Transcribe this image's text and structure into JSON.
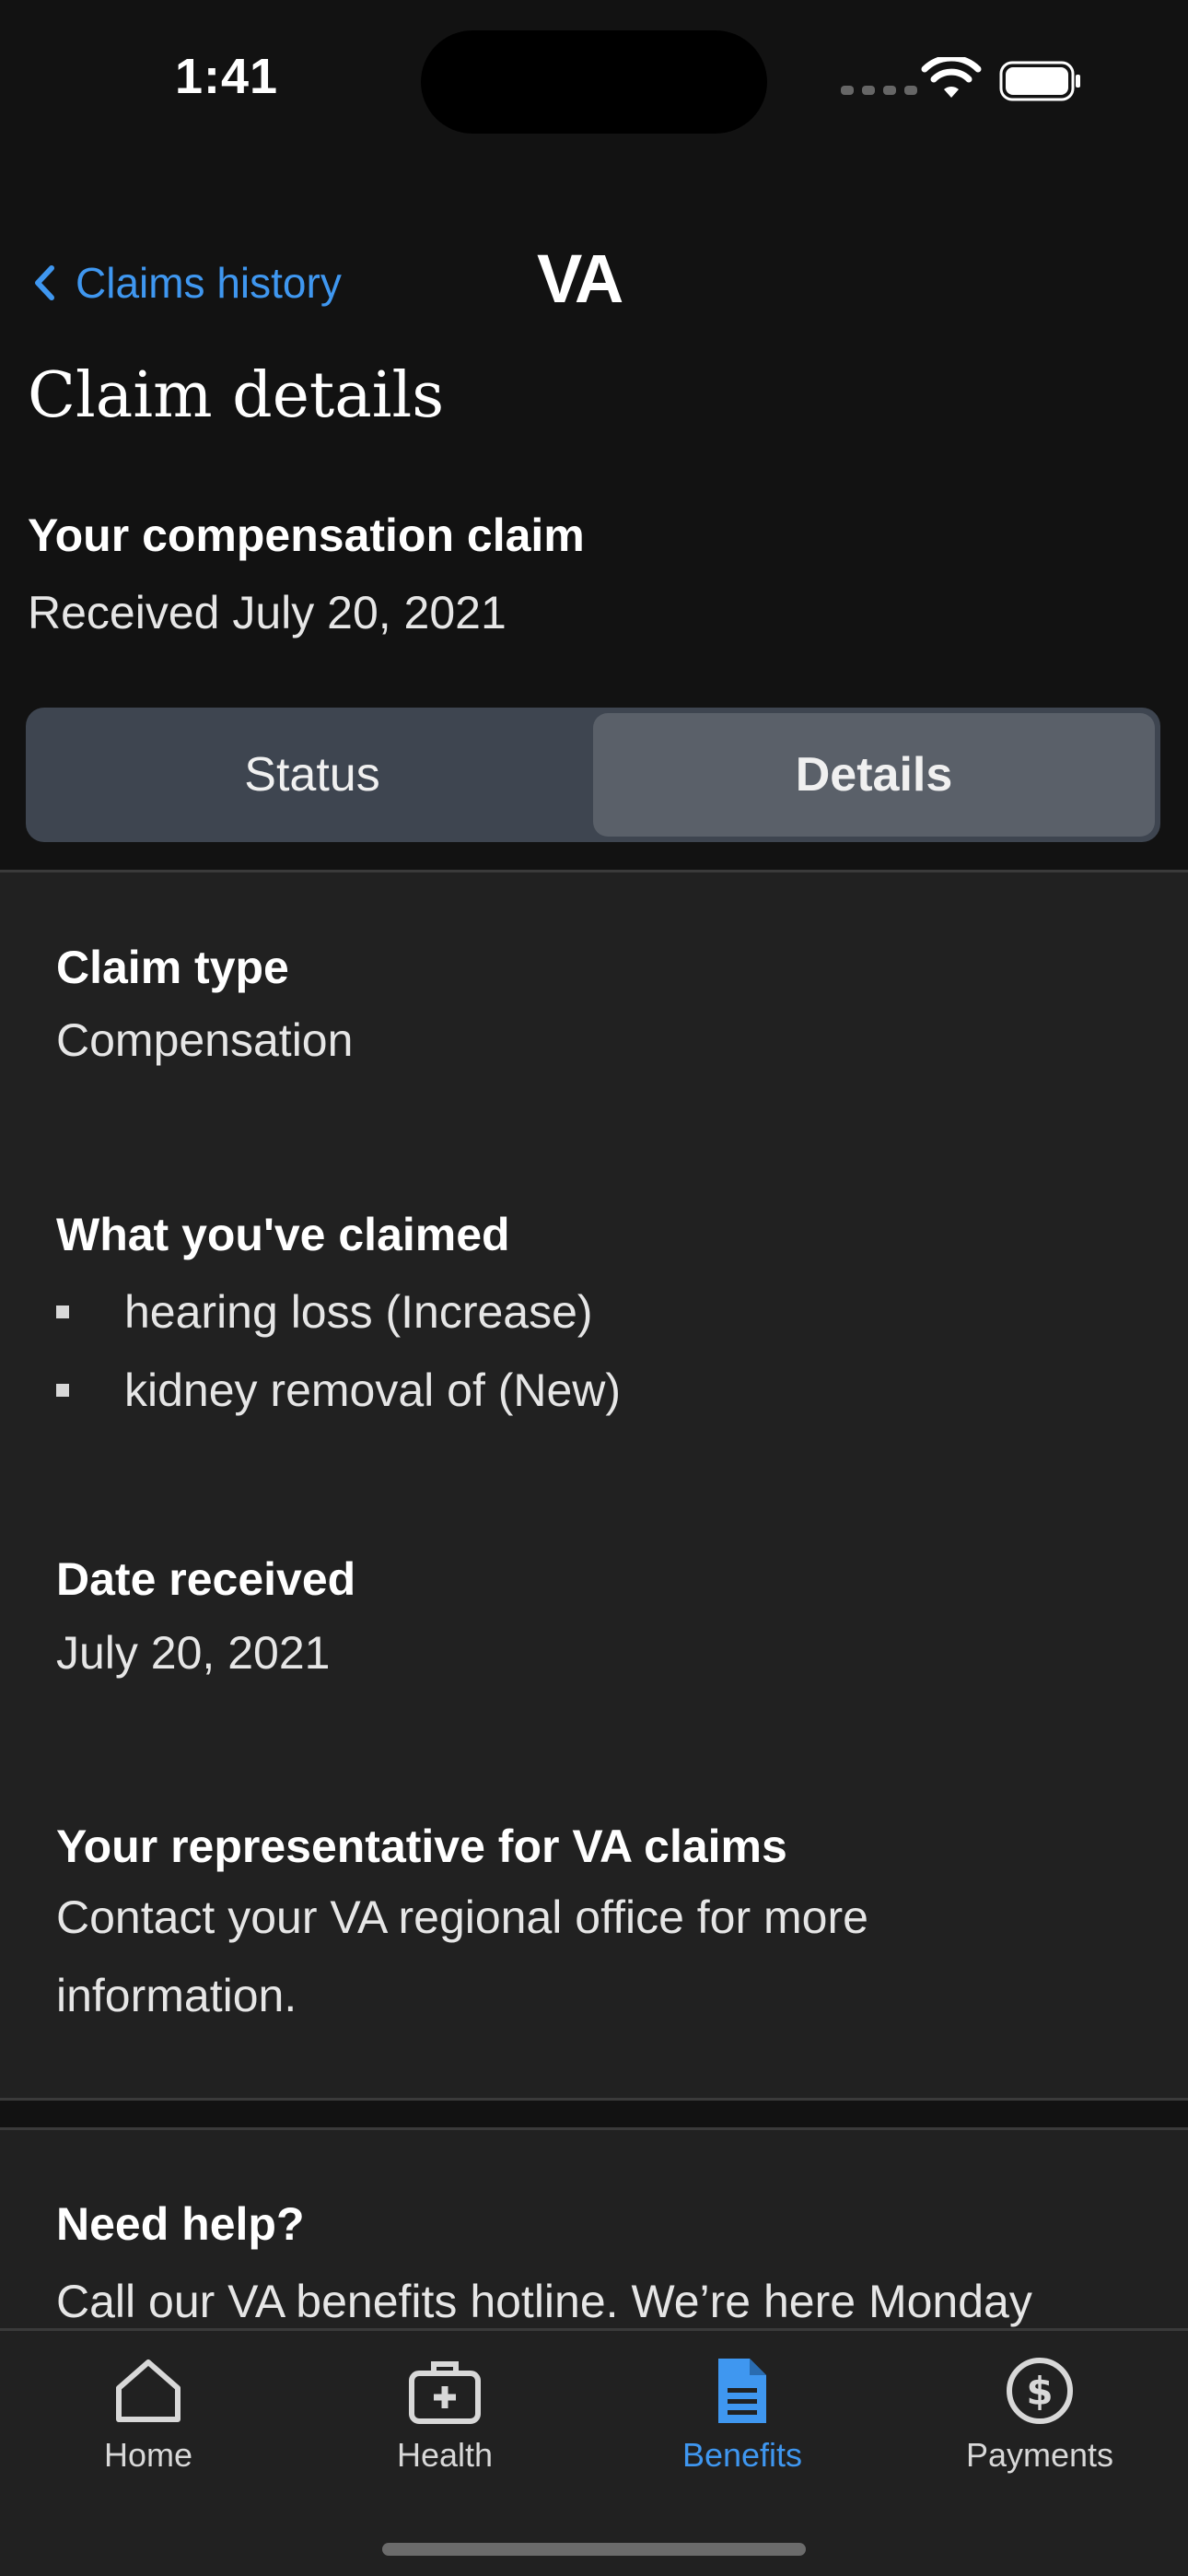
{
  "status_bar": {
    "time": "1:41"
  },
  "nav": {
    "back_label": "Claims history",
    "logo": "VA"
  },
  "page_title": "Claim details",
  "claim": {
    "title": "Your compensation claim",
    "received": "Received July 20, 2021"
  },
  "tabs": [
    {
      "label": "Status",
      "selected": false
    },
    {
      "label": "Details",
      "selected": true
    }
  ],
  "details": {
    "claim_type": {
      "label": "Claim type",
      "value": "Compensation"
    },
    "claimed": {
      "label": "What you've claimed",
      "items": [
        "hearing loss (Increase)",
        "kidney removal of (New)"
      ]
    },
    "date_received": {
      "label": "Date received",
      "value": "July 20, 2021"
    },
    "representative": {
      "label": "Your representative for VA claims",
      "value": "Contact your VA regional office for more information."
    }
  },
  "help": {
    "title": "Need help?",
    "text": "Call our VA benefits hotline. We’re here Monday"
  },
  "tabbar": [
    {
      "label": "Home",
      "icon": "home-icon",
      "active": false
    },
    {
      "label": "Health",
      "icon": "medical-kit-icon",
      "active": false
    },
    {
      "label": "Benefits",
      "icon": "document-icon",
      "active": true
    },
    {
      "label": "Payments",
      "icon": "dollar-circle-icon",
      "active": false
    }
  ],
  "colors": {
    "accent": "#3f97f0",
    "background": "#121212",
    "surface": "#212121",
    "segment_bg": "#3e4550",
    "segment_active": "#5a6069"
  }
}
